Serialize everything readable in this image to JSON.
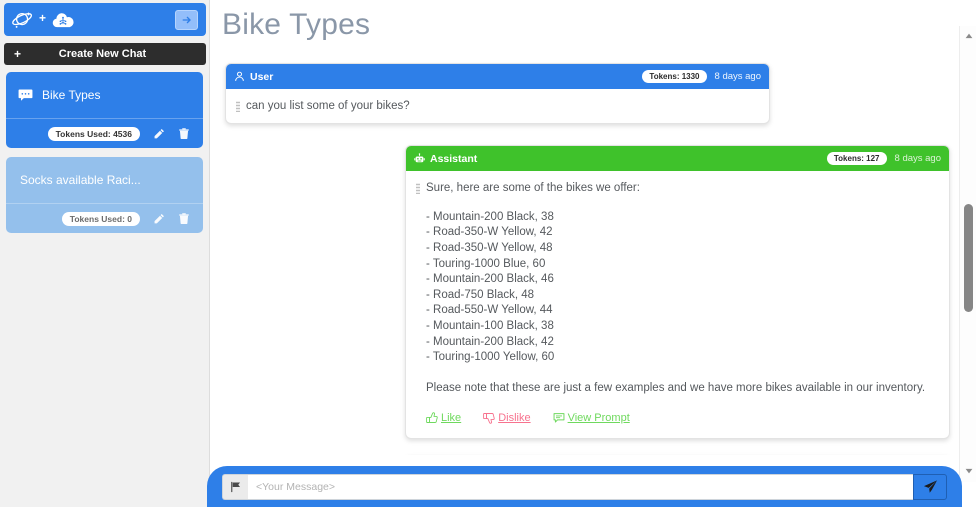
{
  "sidebar": {
    "brand": {
      "planet_icon": "planet-icon",
      "separator": "+",
      "cloud_brain_icon": "cloud-brain-icon",
      "toggle_icon": "arrow-right-icon"
    },
    "new_chat": {
      "plus": "+",
      "label": "Create New Chat"
    },
    "chats": [
      {
        "title": "Bike Types",
        "tokens_label": "Tokens Used: 4536",
        "active": true,
        "icon": "comment-dots-icon",
        "edit_icon": "pencil-icon",
        "delete_icon": "trash-icon"
      },
      {
        "title": "Socks available Raci...",
        "tokens_label": "Tokens Used: 0",
        "active": false,
        "icon": "comment-dots-icon",
        "edit_icon": "pencil-icon",
        "delete_icon": "trash-icon"
      }
    ]
  },
  "main": {
    "page_title": "Bike Types",
    "messages": {
      "user": {
        "role_label": "User",
        "role_icon": "user-icon",
        "tokens_badge": "Tokens: 1330",
        "timestamp": "8 days ago",
        "text": "can you list some of your bikes?"
      },
      "assistant": {
        "role_label": "Assistant",
        "role_icon": "robot-icon",
        "tokens_badge": "Tokens: 127",
        "timestamp": "8 days ago",
        "intro": "Sure, here are some of the bikes we offer:",
        "bikes": [
          "- Mountain-200 Black, 38",
          "- Road-350-W Yellow, 42",
          "- Road-350-W Yellow, 48",
          "- Touring-1000 Blue, 60",
          "- Mountain-200 Black, 46",
          "- Road-750 Black, 48",
          "- Road-550-W Yellow, 44",
          "- Mountain-100 Black, 38",
          "- Mountain-200 Black, 42",
          "- Touring-1000 Yellow, 60"
        ],
        "closing": "Please note that these are just a few examples and we have more bikes available in our inventory.",
        "actions": {
          "like": "Like",
          "dislike": "Dislike",
          "view_prompt": "View Prompt"
        }
      }
    }
  },
  "composer": {
    "flag_icon": "flag-icon",
    "placeholder": "<Your Message>",
    "value": "",
    "send_icon": "paper-plane-icon"
  },
  "scrollbar": {
    "up_icon": "caret-up-icon",
    "down_icon": "caret-down-icon"
  },
  "colors": {
    "primary_blue": "#2e7fe8",
    "assistant_green": "#3fc22b",
    "inactive_blue": "#94c0ec",
    "dark_button": "#2d2d2d",
    "like_green": "#6fd95e",
    "dislike_pink": "#f7728e",
    "title_gray": "#8a97a8"
  }
}
